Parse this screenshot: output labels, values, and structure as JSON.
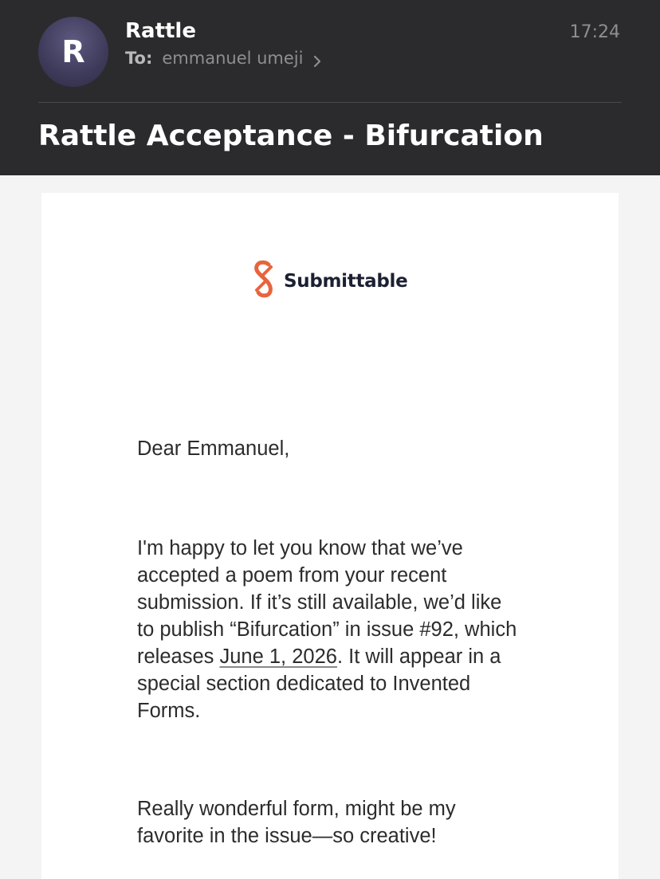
{
  "email": {
    "sender_initial": "R",
    "sender_name": "Rattle",
    "to_label": "To:",
    "recipient": "emmanuel umeji",
    "time": "17:24",
    "subject": "Rattle Acceptance - Bifurcation"
  },
  "logo": {
    "text": "Submittable",
    "color": "#e8643c"
  },
  "message": {
    "greeting": "Dear Emmanuel,",
    "para1_before": "I'm happy to let you know that we’ve accepted a poem from your recent submission. If it’s still available, we’d like to publish “Bifurcation” in issue #92, which releases ",
    "para1_date": "June 1, 2026",
    "para1_after": ". It will appear in a special section dedicated to Invented Forms.",
    "para2": "Really wonderful form, might be my favorite in the issue—so creative!"
  }
}
